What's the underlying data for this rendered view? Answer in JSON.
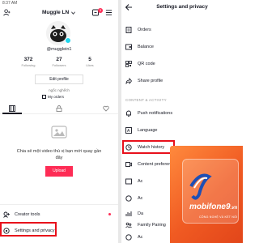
{
  "profile": {
    "status_time": "8:37 AM",
    "username": "Muggle LN",
    "notification_count": "3",
    "handle": "@mugglein1",
    "stats": [
      {
        "value": "372",
        "label": "Following"
      },
      {
        "value": "27",
        "label": "Followers"
      },
      {
        "value": "5",
        "label": "Likes"
      }
    ],
    "edit_label": "Edit profile",
    "bio": "ngốc nghếch",
    "orders_label": "My orders",
    "empty_text": "Chia sẻ một video thú vị bạn mới quay gần đây",
    "upload_label": "Upload",
    "sheet_items": [
      {
        "label": "Creator tools",
        "icon": "creator-tools-icon"
      },
      {
        "label": "Settings and privacy",
        "icon": "settings-icon"
      }
    ]
  },
  "settings": {
    "title": "Settings and privacy",
    "items": [
      {
        "label": "Orders",
        "icon": "orders-icon"
      },
      {
        "label": "Balance",
        "icon": "balance-icon"
      },
      {
        "label": "QR code",
        "icon": "qr-code-icon"
      },
      {
        "label": "Share profile",
        "icon": "share-icon"
      }
    ],
    "section_label": "CONTENT & ACTIVITY",
    "activity_items": [
      {
        "label": "Push notifications",
        "icon": "bell-icon"
      },
      {
        "label": "Language",
        "icon": "language-icon"
      },
      {
        "label": "Watch history",
        "icon": "history-icon"
      },
      {
        "label": "Content preferences",
        "icon": "video-icon"
      },
      {
        "label": "Ac",
        "icon": "ads-icon"
      },
      {
        "label": "Ac",
        "icon": "accessibility-icon"
      },
      {
        "label": "Da",
        "icon": "data-icon"
      },
      {
        "label": "Family Pairing",
        "icon": "family-icon"
      },
      {
        "label": "Ac",
        "icon": "account-icon"
      }
    ]
  },
  "watermark": {
    "brand": "mobifone9",
    "domain": ".vn",
    "tagline": "CÔNG NGHỆ VÀ KẾT NỐI"
  },
  "colors": {
    "accent": "#fe2c55",
    "highlight": "#e8101b",
    "watermark": "#f05a22"
  }
}
